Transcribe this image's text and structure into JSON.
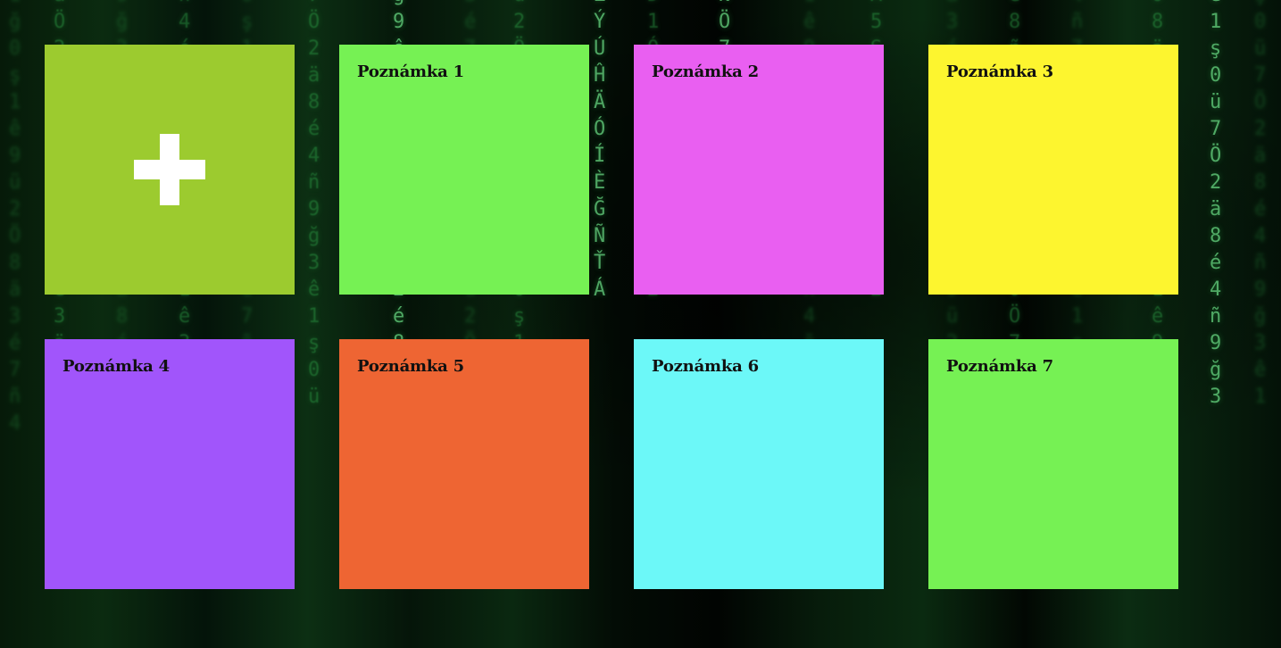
{
  "add_note": {
    "icon": "plus-icon",
    "color": "#9ccb2f"
  },
  "notes": [
    {
      "title": "Poznámka 1",
      "color": "#76f154"
    },
    {
      "title": "Poznámka 2",
      "color": "#e95ff1"
    },
    {
      "title": "Poznámka 3",
      "color": "#fdf52f"
    },
    {
      "title": "Poznámka 4",
      "color": "#a155fb"
    },
    {
      "title": "Poznámka 5",
      "color": "#ee6533"
    },
    {
      "title": "Poznámka 6",
      "color": "#6cf8f8"
    },
    {
      "title": "Poznámka 7",
      "color": "#76f154"
    }
  ]
}
